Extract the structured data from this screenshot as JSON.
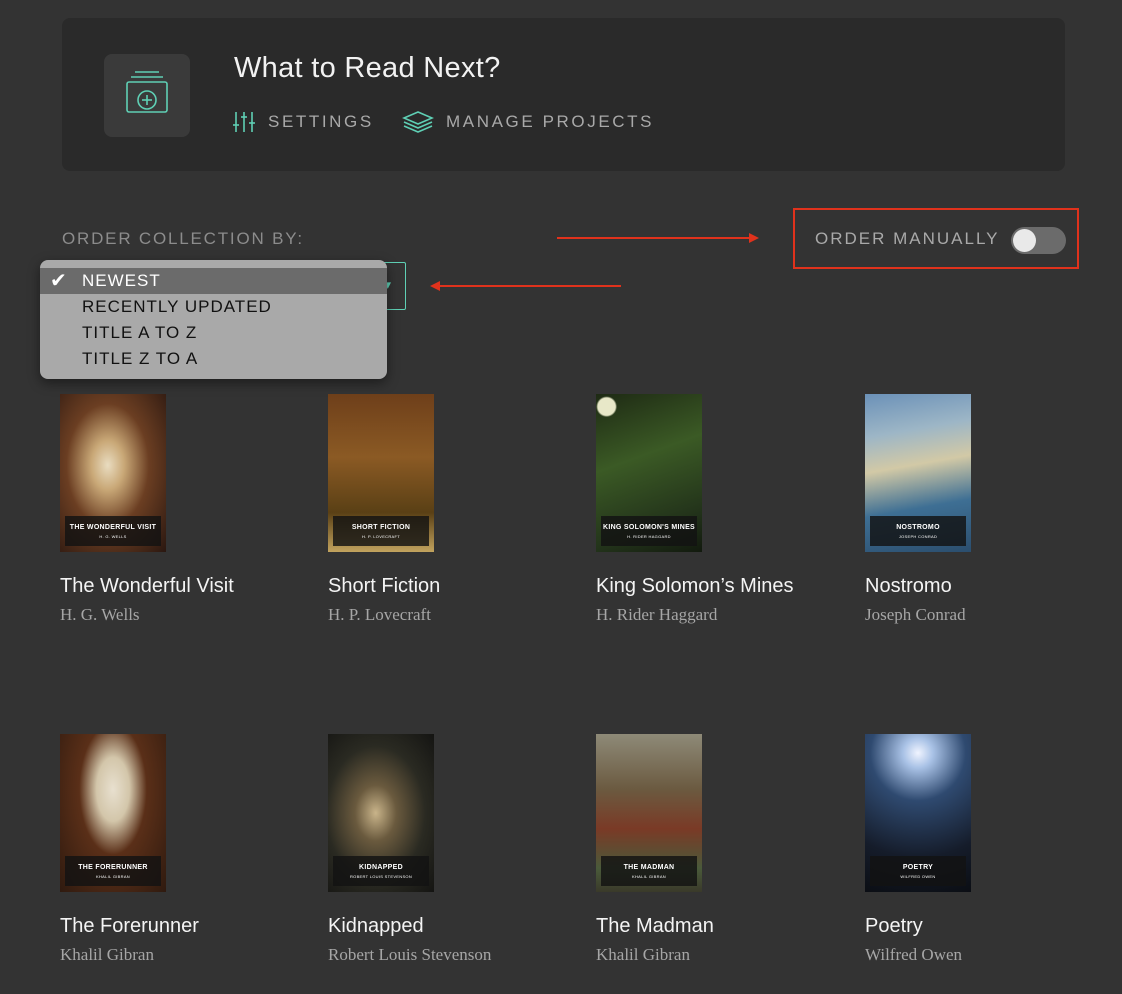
{
  "header": {
    "title": "What to Read Next?",
    "settings_label": "SETTINGS",
    "manage_label": "MANAGE PROJECTS",
    "accent_color": "#5fd0b5"
  },
  "ordering": {
    "label": "ORDER COLLECTION BY:",
    "options": [
      "NEWEST",
      "RECENTLY UPDATED",
      "TITLE A TO Z",
      "TITLE Z TO A"
    ],
    "selected": "NEWEST",
    "manual_label": "ORDER MANUALLY",
    "manual_enabled": false,
    "annotation_color": "#e0321c"
  },
  "books": [
    {
      "title": "The Wonderful Visit",
      "author": "H. G. Wells",
      "cover_title": "THE WONDERFUL VISIT",
      "cover_author": "H. G. WELLS"
    },
    {
      "title": "Short Fiction",
      "author": "H. P. Lovecraft",
      "cover_title": "SHORT FICTION",
      "cover_author": "H. P. LOVECRAFT"
    },
    {
      "title": "King Solomon’s Mines",
      "author": "H. Rider Haggard",
      "cover_title": "KING SOLOMON'S MINES",
      "cover_author": "H. RIDER HAGGARD"
    },
    {
      "title": "Nostromo",
      "author": "Joseph Conrad",
      "cover_title": "NOSTROMO",
      "cover_author": "JOSEPH CONRAD"
    },
    {
      "title": "The Forerunner",
      "author": "Khalil Gibran",
      "cover_title": "THE FORERUNNER",
      "cover_author": "KHALIL GIBRAN"
    },
    {
      "title": "Kidnapped",
      "author": "Robert Louis Stevenson",
      "cover_title": "KIDNAPPED",
      "cover_author": "ROBERT LOUIS STEVENSON"
    },
    {
      "title": "The Madman",
      "author": "Khalil Gibran",
      "cover_title": "THE MADMAN",
      "cover_author": "KHALIL GIBRAN"
    },
    {
      "title": "Poetry",
      "author": "Wilfred Owen",
      "cover_title": "POETRY",
      "cover_author": "WILFRED OWEN"
    }
  ]
}
